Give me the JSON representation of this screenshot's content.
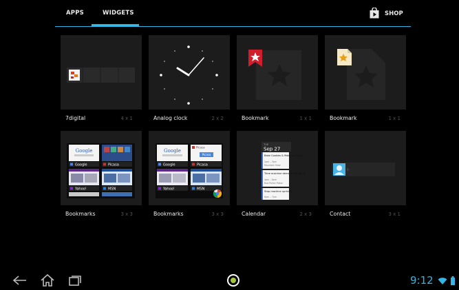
{
  "tabs": {
    "apps": "APPS",
    "widgets": "WIDGETS",
    "active": "WIDGETS"
  },
  "shop": {
    "label": "SHOP",
    "icon": "shopping-bag-icon"
  },
  "widgets": [
    {
      "name": "7digital",
      "size": "4 x 1"
    },
    {
      "name": "Analog clock",
      "size": "2 x 2"
    },
    {
      "name": "Bookmark",
      "size": "1 x 1"
    },
    {
      "name": "Bookmark",
      "size": "1 x 1"
    },
    {
      "name": "Bookmarks",
      "size": "3 x 3"
    },
    {
      "name": "Bookmarks",
      "size": "3 x 3"
    },
    {
      "name": "Calendar",
      "size": "2 x 3"
    },
    {
      "name": "Contact",
      "size": "3 x 1"
    }
  ],
  "previews": {
    "bookmarks_a": [
      "Google",
      "Picasa",
      "Yahoo!",
      "MSN"
    ],
    "bookmarks_b": [
      "Google",
      "Picasa",
      "Yahoo!",
      "MSN"
    ],
    "bookmarks_b_button": "Picasa",
    "calendar": {
      "day": "TUE",
      "date": "Sep 27",
      "events": [
        {
          "title": "Bake Cookies & Make Ice Cream",
          "time": "2pm – 3pm",
          "place": "Mountain View"
        },
        {
          "title": "Time machine demo for Bergenly",
          "time": "4pm – 6pm",
          "place": "Bud Pollan Pollan"
        },
        {
          "title": "Stop machine uprising",
          "time": "6pm – 7pm",
          "place": ""
        }
      ]
    }
  },
  "navbar": {
    "back": "back-arrow-icon",
    "home": "home-icon",
    "recents": "recent-apps-icon",
    "launcher": "all-apps-icon"
  },
  "status": {
    "time": "9:12",
    "wifi": "wifi-icon",
    "battery": "battery-icon"
  },
  "colors": {
    "accent": "#33b5e5",
    "tile": "#1c1c1c",
    "background": "#000000",
    "bookmark_red": "#d01f2c"
  }
}
